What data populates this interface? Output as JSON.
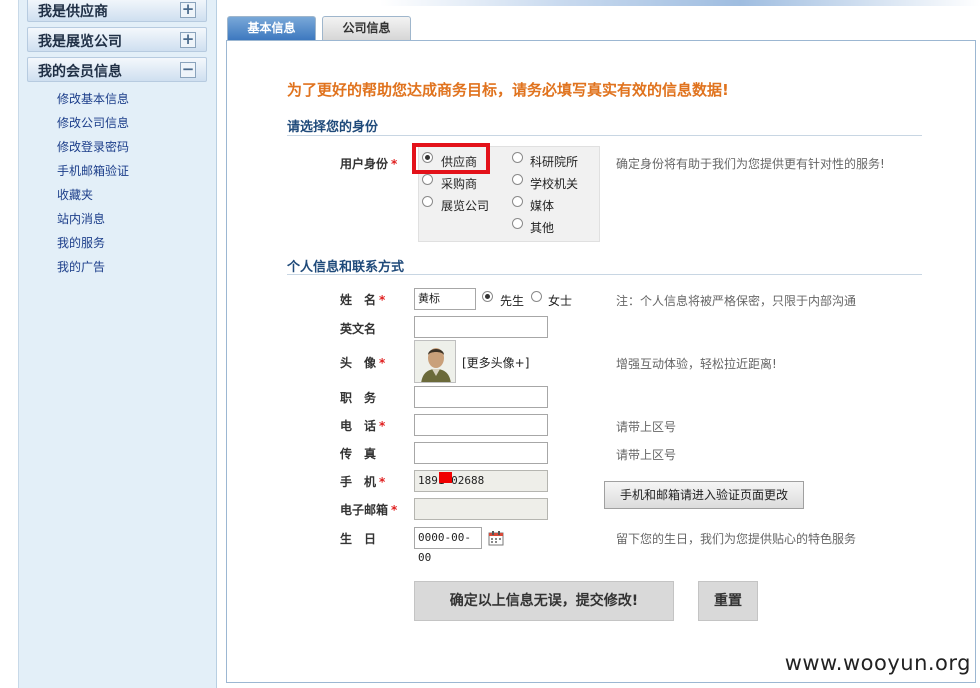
{
  "sidebar": {
    "headers": [
      {
        "label": "我是供应商",
        "toggle": "+"
      },
      {
        "label": "我是展览公司",
        "toggle": "+"
      },
      {
        "label": "我的会员信息",
        "toggle": "−"
      }
    ],
    "links": [
      "修改基本信息",
      "修改公司信息",
      "修改登录密码",
      "手机邮箱验证",
      "收藏夹",
      "站内消息",
      "我的服务",
      "我的广告"
    ]
  },
  "tabs": [
    {
      "label": "基本信息",
      "active": true
    },
    {
      "label": "公司信息",
      "active": false
    }
  ],
  "form": {
    "notice": "为了更好的帮助您达成商务目标，请务必填写真实有效的信息数据!",
    "section1_title": "请选择您的身份",
    "identity": {
      "label": "用户身份",
      "required_mark": "*",
      "options_col1": [
        "供应商",
        "采购商",
        "展览公司"
      ],
      "options_col2": [
        "科研院所",
        "学校机关",
        "媒体",
        "其他"
      ],
      "selected": "供应商",
      "hint": "确定身份将有助于我们为您提供更有针对性的服务!"
    },
    "section2_title": "个人信息和联系方式",
    "name": {
      "label": "姓　名",
      "value": "黄标",
      "gender_options": [
        "先生",
        "女士"
      ],
      "gender_selected": "先生",
      "hint": "注：个人信息将被严格保密，只限于内部沟通"
    },
    "english_name": {
      "label": "英文名",
      "value": ""
    },
    "avatar": {
      "label": "头　像",
      "more_link": "[更多头像+]",
      "hint": "增强互动体验，轻松拉近距离!"
    },
    "title": {
      "label": "职　务",
      "value": ""
    },
    "phone": {
      "label": "电　话",
      "value": "",
      "hint": "请带上区号"
    },
    "fax": {
      "label": "传　真",
      "value": "",
      "hint": "请带上区号"
    },
    "mobile": {
      "label": "手　机",
      "value": "1891  02688"
    },
    "email": {
      "label": "电子邮箱",
      "value": ""
    },
    "verify_button": "手机和邮箱请进入验证页面更改",
    "birthday": {
      "label": "生　日",
      "value": "0000-00-00",
      "hint": "留下您的生日，我们为您提供贴心的特色服务"
    },
    "submit_label": "确定以上信息无误，提交修改!",
    "reset_label": "重置"
  },
  "watermark": "www.wooyun.org",
  "colors": {
    "notice": "#e0731e",
    "section_title": "#1f4a7a",
    "required": "#e02020",
    "highlight_box": "#e3121a",
    "tab_active": "#3d78bf",
    "sidebar_bg": "#e3eff8"
  }
}
